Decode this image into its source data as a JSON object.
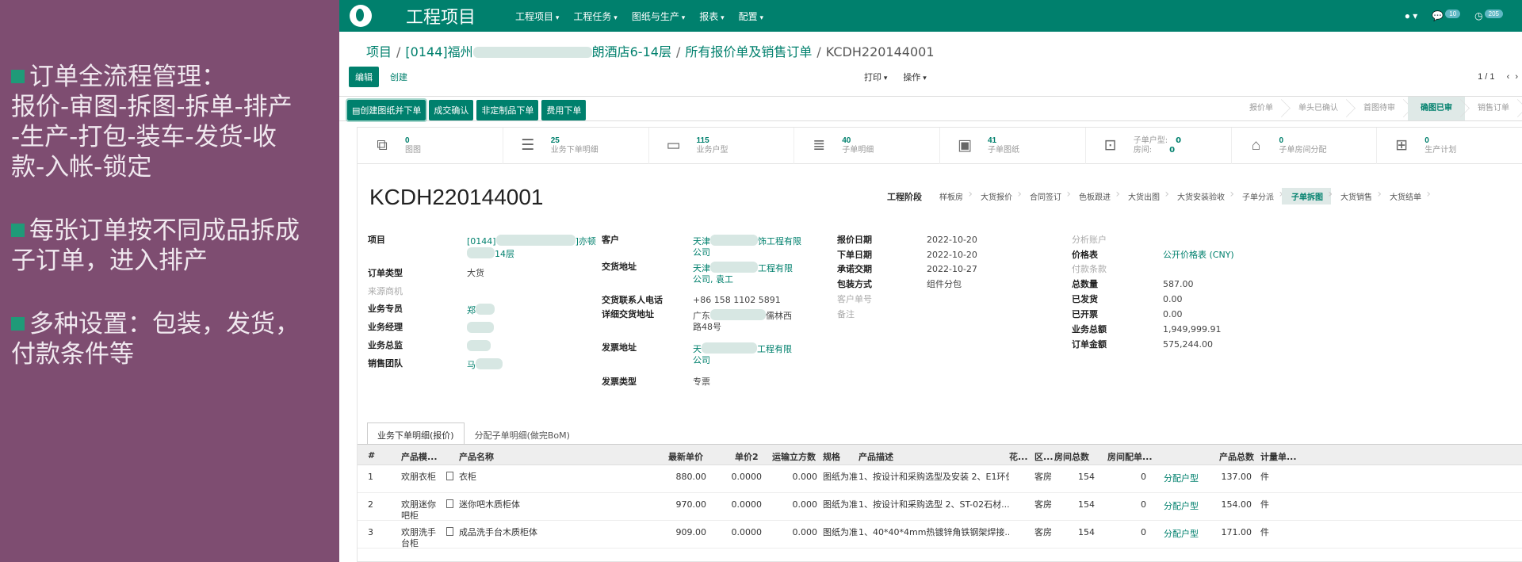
{
  "slide": {
    "bullets": [
      "订单全流程管理：\n报价-审图-拆图-拆单-排产\n-生产-打包-装车-发货-收\n款-入帐-锁定",
      "每张订单按不同成品拆成\n子订单，进入排产",
      "多种设置：包装，发货，\n付款条件等"
    ]
  },
  "topbar": {
    "app_title": "工程项目",
    "menu": [
      "工程项目",
      "工程任务",
      "图纸与生产",
      "报表",
      "配置"
    ],
    "messages_count": "10",
    "activities_count": "205"
  },
  "breadcrumb": {
    "root": "项目",
    "project_prefix": "[0144]福州",
    "project_suffix": "朗酒店6-14层",
    "list": "所有报价单及销售订单",
    "current": "KCDH220144001"
  },
  "controls": {
    "edit": "编辑",
    "create": "创建",
    "print": "打印",
    "action": "操作",
    "pager": "1 / 1"
  },
  "action_buttons": [
    "创建图纸并下单",
    "成交确认",
    "非定制品下单",
    "费用下单"
  ],
  "status_steps": [
    "报价单",
    "单头已确认",
    "首图待审",
    "确图已审",
    "销售订单"
  ],
  "status_active": 3,
  "stats": [
    {
      "icon": "drawing-icon",
      "glyph": "⧉",
      "num": "0",
      "label": "图图"
    },
    {
      "icon": "list-icon",
      "glyph": "☰",
      "num": "25",
      "label": "业务下单明细"
    },
    {
      "icon": "folder-icon",
      "glyph": "▭",
      "num": "115",
      "label": "业务户型"
    },
    {
      "icon": "numbered-list-icon",
      "glyph": "≣",
      "num": "40",
      "label": "子单明细"
    },
    {
      "icon": "image-icon",
      "glyph": "▣",
      "num": "41",
      "label": "子单图纸"
    },
    {
      "icon": "blueprint-icon",
      "glyph": "⊡",
      "pair1_label": "子单户型:",
      "pair1_num": "0",
      "pair2_label": "房间:",
      "pair2_num": "0"
    },
    {
      "icon": "bed-icon",
      "glyph": "⌂",
      "num": "0",
      "label": "子单房间分配"
    },
    {
      "icon": "calendar-plus-icon",
      "glyph": "⊞",
      "num": "0",
      "label": "生产计划"
    }
  ],
  "order": {
    "number": "KCDH220144001",
    "stage_label": "工程阶段",
    "stages": [
      "样板房",
      "大货报价",
      "合同签订",
      "色板跟进",
      "大货出图",
      "大货安装验收",
      "子单分派",
      "子单拆图",
      "大货销售",
      "大货结单"
    ],
    "stage_active": 7
  },
  "col1": {
    "project_label": "项目",
    "project_value_a": "[0144]",
    "project_value_b": "]亦顿",
    "project_value_c": "14层",
    "order_type_label": "订单类型",
    "order_type_value": "大货",
    "source_label": "来源商机",
    "sales_rep_label": "业务专员",
    "sales_rep_value": "郑",
    "sales_mgr_label": "业务经理",
    "sales_dir_label": "业务总监",
    "team_label": "销售团队",
    "team_value": "马"
  },
  "col2": {
    "customer_label": "客户",
    "customer_value_a": "天津",
    "customer_value_b": "饰工程有限",
    "customer_value_c": "公司",
    "delivery_addr_label": "交货地址",
    "delivery_addr_a": "天津",
    "delivery_addr_b": "工程有限",
    "delivery_addr_c": "公司, 袁工",
    "contact_phone_label": "交货联系人电话",
    "contact_phone_value": "+86 158 1102 5891",
    "detail_addr_label": "详细交货地址",
    "detail_addr_a": "广东",
    "detail_addr_b": "儒林西",
    "detail_addr_c": "路48号",
    "invoice_addr_label": "发票地址",
    "invoice_addr_a": "天",
    "invoice_addr_b": "工程有限",
    "invoice_addr_c": "公司",
    "invoice_type_label": "发票类型",
    "invoice_type_value": "专票"
  },
  "col3": {
    "quote_date_label": "报价日期",
    "quote_date_value": "2022-10-20",
    "order_date_label": "下单日期",
    "order_date_value": "2022-10-20",
    "commit_date_label": "承诺交期",
    "commit_date_value": "2022-10-27",
    "packing_label": "包装方式",
    "packing_value": "组件分包",
    "customer_ref_label": "客户单号",
    "note_label": "备注"
  },
  "col4": {
    "analytic_label": "分析账户",
    "pricelist_label": "价格表",
    "pricelist_value": "公开价格表 (CNY)",
    "payment_label": "付款条款",
    "total_qty_label": "总数量",
    "total_qty_value": "587.00",
    "shipped_label": "已发货",
    "shipped_value": "0.00",
    "invoiced_label": "已开票",
    "invoiced_value": "0.00",
    "biz_total_label": "业务总额",
    "biz_total_value": "1,949,999.91",
    "order_amount_label": "订单金额",
    "order_amount_value": "575,244.00"
  },
  "tabs": [
    "业务下单明细(报价)",
    "分配子单明细(做完BoM)"
  ],
  "table": {
    "headers": [
      "#",
      "产品模...",
      "产品名称",
      "最新单价",
      "单价2",
      "运输立方数",
      "规格",
      "产品描述",
      "花...",
      "区...",
      "房间总数",
      "房间配单...",
      "产品总数",
      "计量单..."
    ],
    "rows": [
      {
        "no": "1",
        "model": "欢朋衣柜",
        "model2": "",
        "name": "衣柜",
        "price": "880.00",
        "price2": "0.0000",
        "cube": "0.000",
        "spec": "图纸为准",
        "desc": "1、按设计和采购选型及安装 2、E1环保...",
        "area": "客房",
        "rooms": "154",
        "room_alloc": "0",
        "assign": "分配户型",
        "total": "137.00",
        "unit": "件"
      },
      {
        "no": "2",
        "model": "欢朋迷你",
        "model2": "吧柜",
        "name": "迷你吧木质柜体",
        "price": "970.00",
        "price2": "0.0000",
        "cube": "0.000",
        "spec": "图纸为准",
        "desc": "1、按设计和采购选型 2、ST-02石材...",
        "area": "客房",
        "rooms": "154",
        "room_alloc": "0",
        "assign": "分配户型",
        "total": "154.00",
        "unit": "件"
      },
      {
        "no": "3",
        "model": "欢朋洗手",
        "model2": "台柜",
        "name": "成品洗手台木质柜体",
        "price": "909.00",
        "price2": "0.0000",
        "cube": "0.000",
        "spec": "图纸为准",
        "desc": "1、40*40*4mm热镀锌角铁钢架焊接...",
        "area": "客房",
        "rooms": "154",
        "room_alloc": "0",
        "assign": "分配户型",
        "total": "171.00",
        "unit": "件"
      }
    ]
  }
}
